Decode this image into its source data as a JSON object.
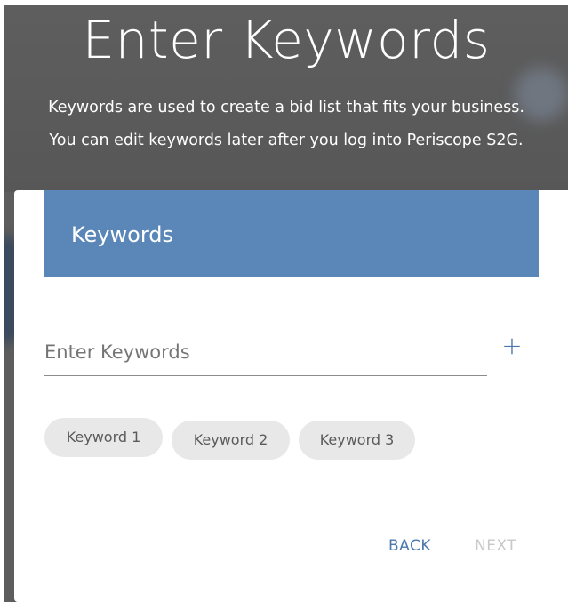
{
  "header": {
    "title": "Enter Keywords",
    "subtitle_line1": "Keywords are used to create a bid list that fits your business.",
    "subtitle_line2": "You can edit keywords later after you log into Periscope S2G."
  },
  "card": {
    "title": "Keywords",
    "input": {
      "placeholder": "Enter Keywords",
      "value": ""
    },
    "add_icon": "plus-icon",
    "add_label": "+",
    "chips": [
      "Keyword 1",
      "Keyword 2",
      "Keyword 3"
    ],
    "actions": {
      "back_label": "BACK",
      "next_label": "NEXT"
    }
  },
  "colors": {
    "header_bg": "#5d5d5d",
    "card_header_bg": "#5a87b8",
    "accent": "#4a78ae",
    "chip_bg": "#e8e8e8",
    "disabled": "#c8c8c8"
  }
}
